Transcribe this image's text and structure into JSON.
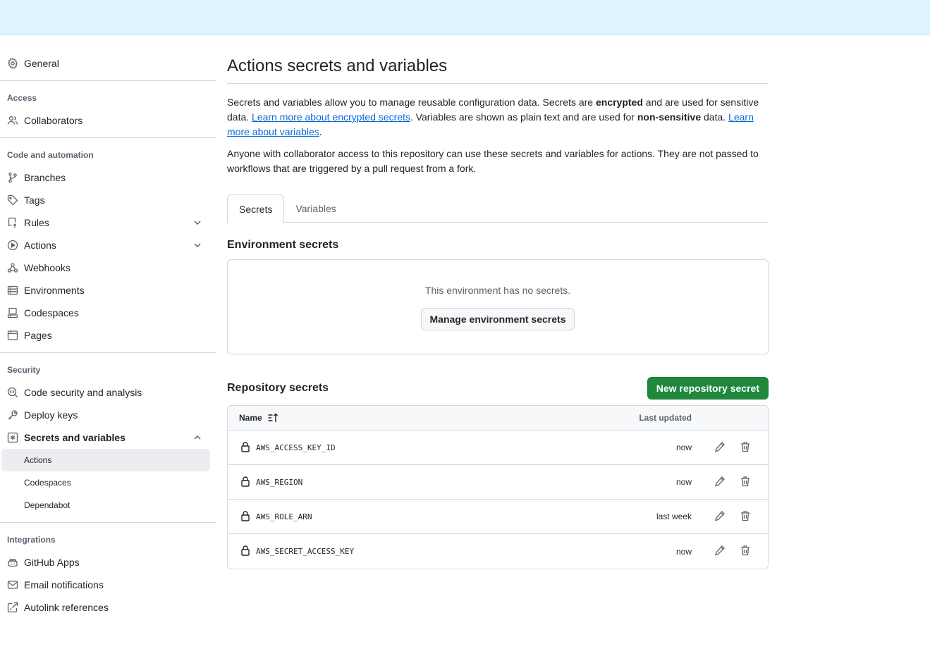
{
  "sidebar": {
    "general": "General",
    "groups": {
      "access": "Access",
      "code": "Code and automation",
      "security": "Security",
      "integrations": "Integrations"
    },
    "items": {
      "collaborators": "Collaborators",
      "branches": "Branches",
      "tags": "Tags",
      "rules": "Rules",
      "actions": "Actions",
      "webhooks": "Webhooks",
      "environments": "Environments",
      "codespaces": "Codespaces",
      "pages": "Pages",
      "code_security": "Code security and analysis",
      "deploy_keys": "Deploy keys",
      "secrets_variables": "Secrets and variables",
      "sub_actions": "Actions",
      "sub_codespaces": "Codespaces",
      "sub_dependabot": "Dependabot",
      "github_apps": "GitHub Apps",
      "email_notifications": "Email notifications",
      "autolink_references": "Autolink references"
    }
  },
  "main": {
    "title": "Actions secrets and variables",
    "desc": {
      "p1a": "Secrets and variables allow you to manage reusable configuration data. Secrets are ",
      "p1b": "encrypted",
      "p1c": " and are used for sensitive data. ",
      "link1": "Learn more about encrypted secrets",
      "p1d": ". Variables are shown as plain text and are used for ",
      "p1e": "non-sensitive",
      "p1f": " data. ",
      "link2": "Learn more about variables",
      "p1g": "."
    },
    "desc2": "Anyone with collaborator access to this repository can use these secrets and variables for actions. They are not passed to workflows that are triggered by a pull request from a fork.",
    "tabs": [
      "Secrets",
      "Variables"
    ],
    "env_title": "Environment secrets",
    "env_empty": "This environment has no secrets.",
    "env_button": "Manage environment secrets",
    "repo_title": "Repository secrets",
    "new_button": "New repository secret",
    "table": {
      "col_name": "Name",
      "col_updated": "Last updated",
      "rows": [
        {
          "name": "AWS_ACCESS_KEY_ID",
          "updated": "now"
        },
        {
          "name": "AWS_REGION",
          "updated": "now"
        },
        {
          "name": "AWS_ROLE_ARN",
          "updated": "last week"
        },
        {
          "name": "AWS_SECRET_ACCESS_KEY",
          "updated": "now"
        }
      ]
    }
  },
  "colors": {
    "topbar": "#ddf4ff",
    "primary_button": "#1f883d",
    "link": "#0969da"
  }
}
